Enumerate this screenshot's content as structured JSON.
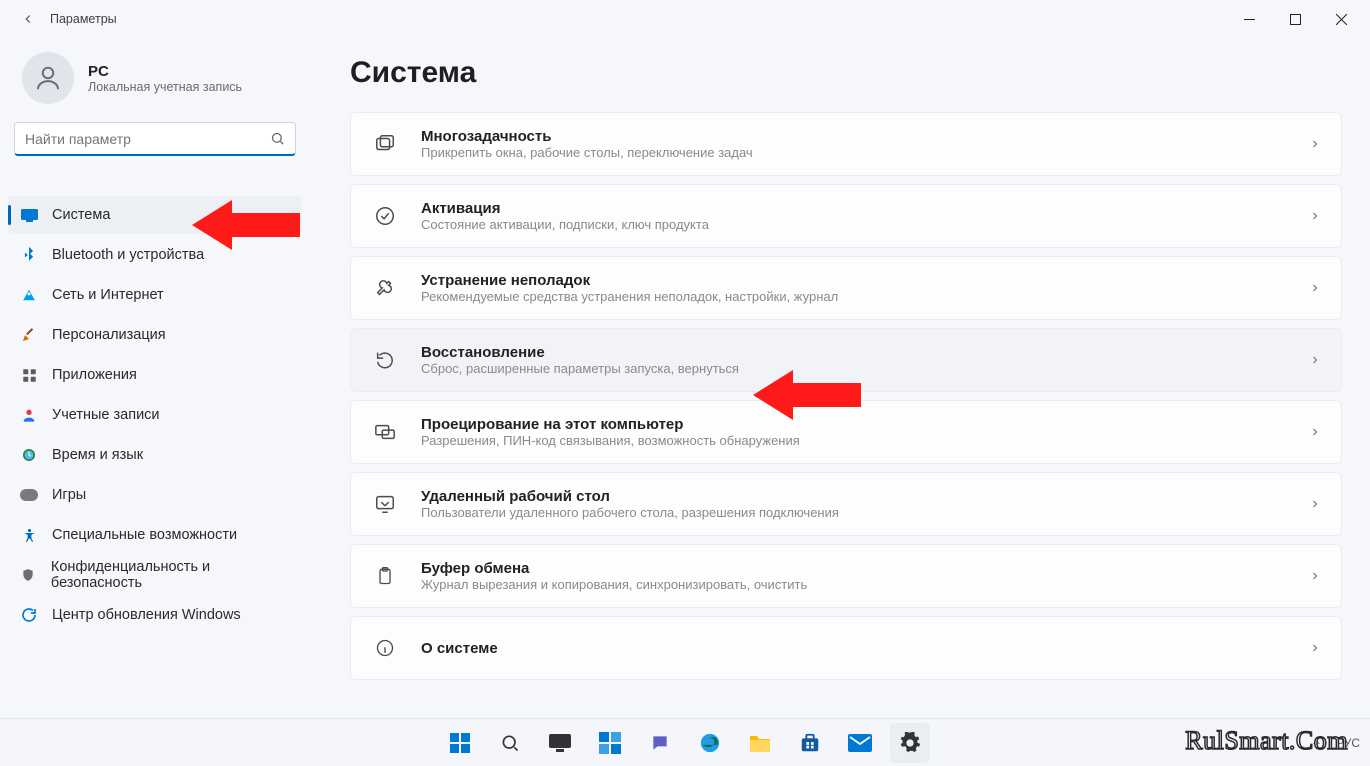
{
  "window": {
    "app_title": "Параметры"
  },
  "profile": {
    "name": "PC",
    "subtitle": "Локальная учетная запись"
  },
  "search": {
    "placeholder": "Найти параметр"
  },
  "sidebar": {
    "items": [
      {
        "label": "Система",
        "icon": "system"
      },
      {
        "label": "Bluetooth и устройства",
        "icon": "bluetooth"
      },
      {
        "label": "Сеть и Интернет",
        "icon": "network"
      },
      {
        "label": "Персонализация",
        "icon": "personalization"
      },
      {
        "label": "Приложения",
        "icon": "apps"
      },
      {
        "label": "Учетные записи",
        "icon": "accounts"
      },
      {
        "label": "Время и язык",
        "icon": "time"
      },
      {
        "label": "Игры",
        "icon": "gaming"
      },
      {
        "label": "Специальные возможности",
        "icon": "accessibility"
      },
      {
        "label": "Конфиденциальность и безопасность",
        "icon": "privacy"
      },
      {
        "label": "Центр обновления Windows",
        "icon": "update"
      }
    ],
    "active_index": 0
  },
  "page": {
    "title": "Система",
    "rows": [
      {
        "title": "Многозадачность",
        "subtitle": "Прикрепить окна, рабочие столы, переключение задач",
        "icon": "multitask"
      },
      {
        "title": "Активация",
        "subtitle": "Состояние активации, подписки, ключ продукта",
        "icon": "activation"
      },
      {
        "title": "Устранение неполадок",
        "subtitle": "Рекомендуемые средства устранения неполадок, настройки, журнал",
        "icon": "troubleshoot"
      },
      {
        "title": "Восстановление",
        "subtitle": "Сброс, расширенные параметры запуска, вернуться",
        "icon": "recovery",
        "highlight": true
      },
      {
        "title": "Проецирование на этот компьютер",
        "subtitle": "Разрешения, ПИН-код связывания, возможность обнаружения",
        "icon": "projecting"
      },
      {
        "title": "Удаленный рабочий стол",
        "subtitle": "Пользователи удаленного рабочего стола, разрешения подключения",
        "icon": "remote"
      },
      {
        "title": "Буфер обмена",
        "subtitle": "Журнал вырезания и копирования, синхронизировать, очистить",
        "icon": "clipboard"
      },
      {
        "title": "О системе",
        "subtitle": "",
        "icon": "about"
      }
    ]
  },
  "taskbar": {
    "lang": "РУС"
  },
  "watermark": "RulSmart.Com"
}
